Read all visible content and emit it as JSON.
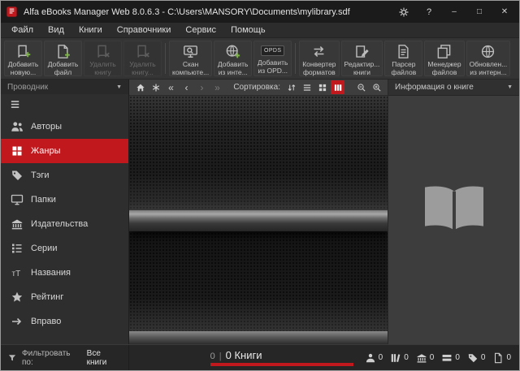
{
  "titlebar": {
    "title": "Alfa eBooks Manager Web 8.0.6.3 - C:\\Users\\MANSORY\\Documents\\mylibrary.sdf"
  },
  "glyphs": {
    "collapse": "▼",
    "nav_first": "«",
    "nav_prev": "‹",
    "nav_next": "›",
    "nav_last": "»",
    "help": "?",
    "minimize": "–",
    "maximize": "□",
    "close": "✕"
  },
  "menubar": {
    "items": [
      "Файл",
      "Вид",
      "Книги",
      "Справочники",
      "Сервис",
      "Помощь"
    ]
  },
  "toolbar": {
    "buttons": [
      {
        "line1": "Добавить",
        "line2": "новую...",
        "enabled": true
      },
      {
        "line1": "Добавить",
        "line2": "файл",
        "enabled": true
      },
      {
        "line1": "Удалить",
        "line2": "книгу",
        "enabled": false
      },
      {
        "line1": "Удалить",
        "line2": "книгу...",
        "enabled": false
      },
      {
        "line1": "Скан",
        "line2": "компьюте...",
        "enabled": true
      },
      {
        "line1": "Добавить",
        "line2": "из инте...",
        "enabled": true
      },
      {
        "line1": "Добавить",
        "line2": "из OPD...",
        "badge": "OPDS",
        "enabled": true
      },
      {
        "line1": "Конвертер",
        "line2": "форматов",
        "enabled": true
      },
      {
        "line1": "Редактир...",
        "line2": "книги",
        "enabled": true
      },
      {
        "line1": "Парсер",
        "line2": "файлов",
        "enabled": true
      },
      {
        "line1": "Менеджер",
        "line2": "файлов",
        "enabled": true
      },
      {
        "line1": "Обновлен...",
        "line2": "из интерн...",
        "enabled": true
      }
    ]
  },
  "sidebar": {
    "header": "Проводник",
    "items": [
      {
        "label": "Авторы",
        "selected": false
      },
      {
        "label": "Жанры",
        "selected": true
      },
      {
        "label": "Тэги",
        "selected": false
      },
      {
        "label": "Папки",
        "selected": false
      },
      {
        "label": "Издательства",
        "selected": false
      },
      {
        "label": "Серии",
        "selected": false
      },
      {
        "label": "Названия",
        "selected": false
      },
      {
        "label": "Рейтинг",
        "selected": false
      },
      {
        "label": "Вправо",
        "selected": false
      }
    ]
  },
  "shelfbar": {
    "sort_label": "Сортировка:"
  },
  "infopanel": {
    "header": "Информация о книге"
  },
  "statusbar": {
    "filter_label": "Фильтровать по:",
    "filter_value": "Все книги",
    "counts": {
      "selected": "0",
      "divider": "|",
      "total": "0 Книги"
    },
    "counters": [
      {
        "value": "0"
      },
      {
        "value": "0"
      },
      {
        "value": "0"
      },
      {
        "value": "0"
      },
      {
        "value": "0"
      },
      {
        "value": "0"
      }
    ]
  },
  "colors": {
    "accent": "#c0181d",
    "selection": "#c0181d"
  }
}
